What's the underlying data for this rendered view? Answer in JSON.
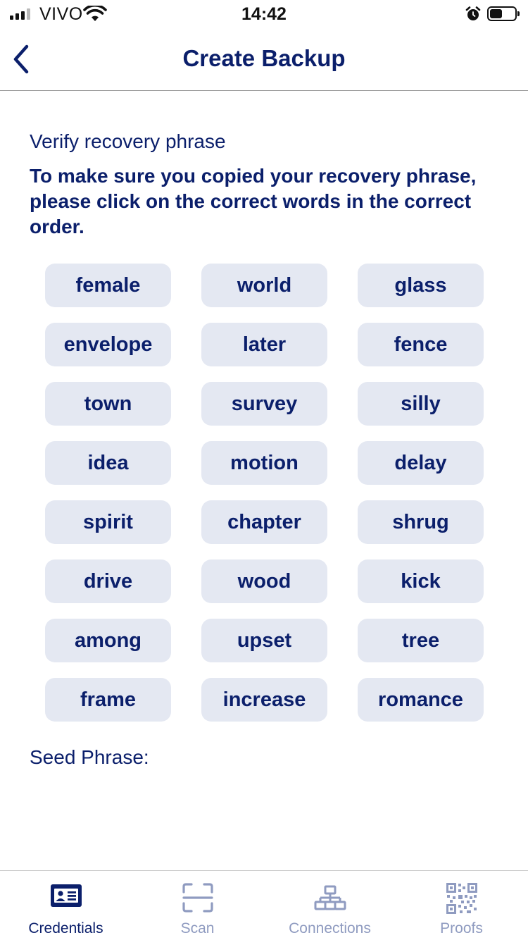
{
  "status_bar": {
    "carrier": "VIVO",
    "time": "14:42"
  },
  "header": {
    "title": "Create Backup",
    "back_icon": "chevron-left-icon"
  },
  "content": {
    "subtitle": "Verify recovery phrase",
    "instructions": "To make sure you copied your recovery phrase, please click on the correct words in the correct order.",
    "words": [
      "female",
      "world",
      "glass",
      "envelope",
      "later",
      "fence",
      "town",
      "survey",
      "silly",
      "idea",
      "motion",
      "delay",
      "spirit",
      "chapter",
      "shrug",
      "drive",
      "wood",
      "kick",
      "among",
      "upset",
      "tree",
      "frame",
      "increase",
      "romance"
    ],
    "seed_phrase_label": "Seed Phrase:"
  },
  "tab_bar": {
    "tabs": [
      {
        "label": "Credentials",
        "icon": "id-card-icon",
        "active": true
      },
      {
        "label": "Scan",
        "icon": "scan-icon",
        "active": false
      },
      {
        "label": "Connections",
        "icon": "network-icon",
        "active": false
      },
      {
        "label": "Proofs",
        "icon": "qr-code-icon",
        "active": false
      }
    ]
  },
  "colors": {
    "primary": "#0b1f6b",
    "chip_background": "#e4e8f2",
    "inactive_tab": "#8f9bc0"
  }
}
